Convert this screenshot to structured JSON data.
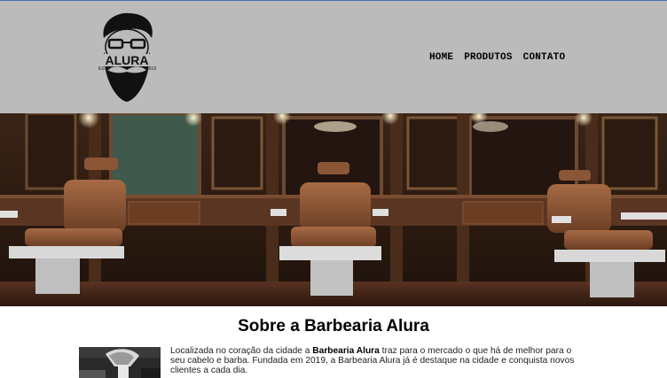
{
  "logo": {
    "brand": "ALURA",
    "estd": "ESTD",
    "year": "2019"
  },
  "nav": {
    "items": [
      {
        "label": "HOME"
      },
      {
        "label": "PRODUTOS"
      },
      {
        "label": "CONTATO"
      }
    ]
  },
  "about": {
    "title": "Sobre a Barbearia Alura",
    "text_before": "Localizada no coração da cidade a ",
    "text_bold": "Barbearia Alura",
    "text_after": " traz para o mercado o que há de melhor para o seu cabelo e barba. Fundada em 2019, a Barbearia Alura já é destaque na cidade e conquista novos clientes a cada dia."
  },
  "colors": {
    "header_bg": "#bbbbbb",
    "accent_line": "#4a6fb0"
  },
  "icons": {
    "logo": "bearded-man-glasses-logo",
    "hero": "barbershop-chairs-photo",
    "about": "shaving-brush-photo"
  }
}
